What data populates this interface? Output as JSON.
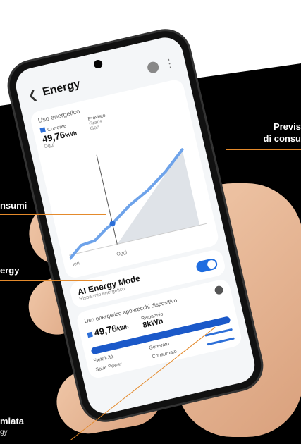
{
  "app": {
    "title": "Energy",
    "usage_card_title": "Uso energetico",
    "current_label": "Corrente",
    "current_value": "49,76",
    "current_unit": "kWh",
    "current_sub": "Oggi",
    "forecast_label": "Previsto",
    "forecast_value": "Gratis",
    "forecast_sub": "Gen",
    "chart_label_start": "Ieri",
    "chart_label_today": "Oggi",
    "ai_mode_title": "AI Energy Mode",
    "ai_mode_subtitle": "Risparmio energetico",
    "devices_title": "Uso energetico apparecchi dispositivo",
    "device_stat_1_value": "49,76",
    "device_stat_1_unit": "kWh",
    "device_stat_2_label": "Risparmio",
    "device_stat_2_value": "8kWh",
    "row1_label": "Elettricità",
    "row1_value": "Generato",
    "row2_label": "Solar Power",
    "row2_value": "Consumato"
  },
  "callouts": {
    "forecast_line1": "Previs",
    "forecast_line2": "di consu",
    "consumption": "nsumi",
    "ai_energy": "ergy",
    "saved": "miata",
    "saved_sub": "gy"
  },
  "colors": {
    "accent": "#1f6de0",
    "callout_line": "#e48a2c"
  }
}
